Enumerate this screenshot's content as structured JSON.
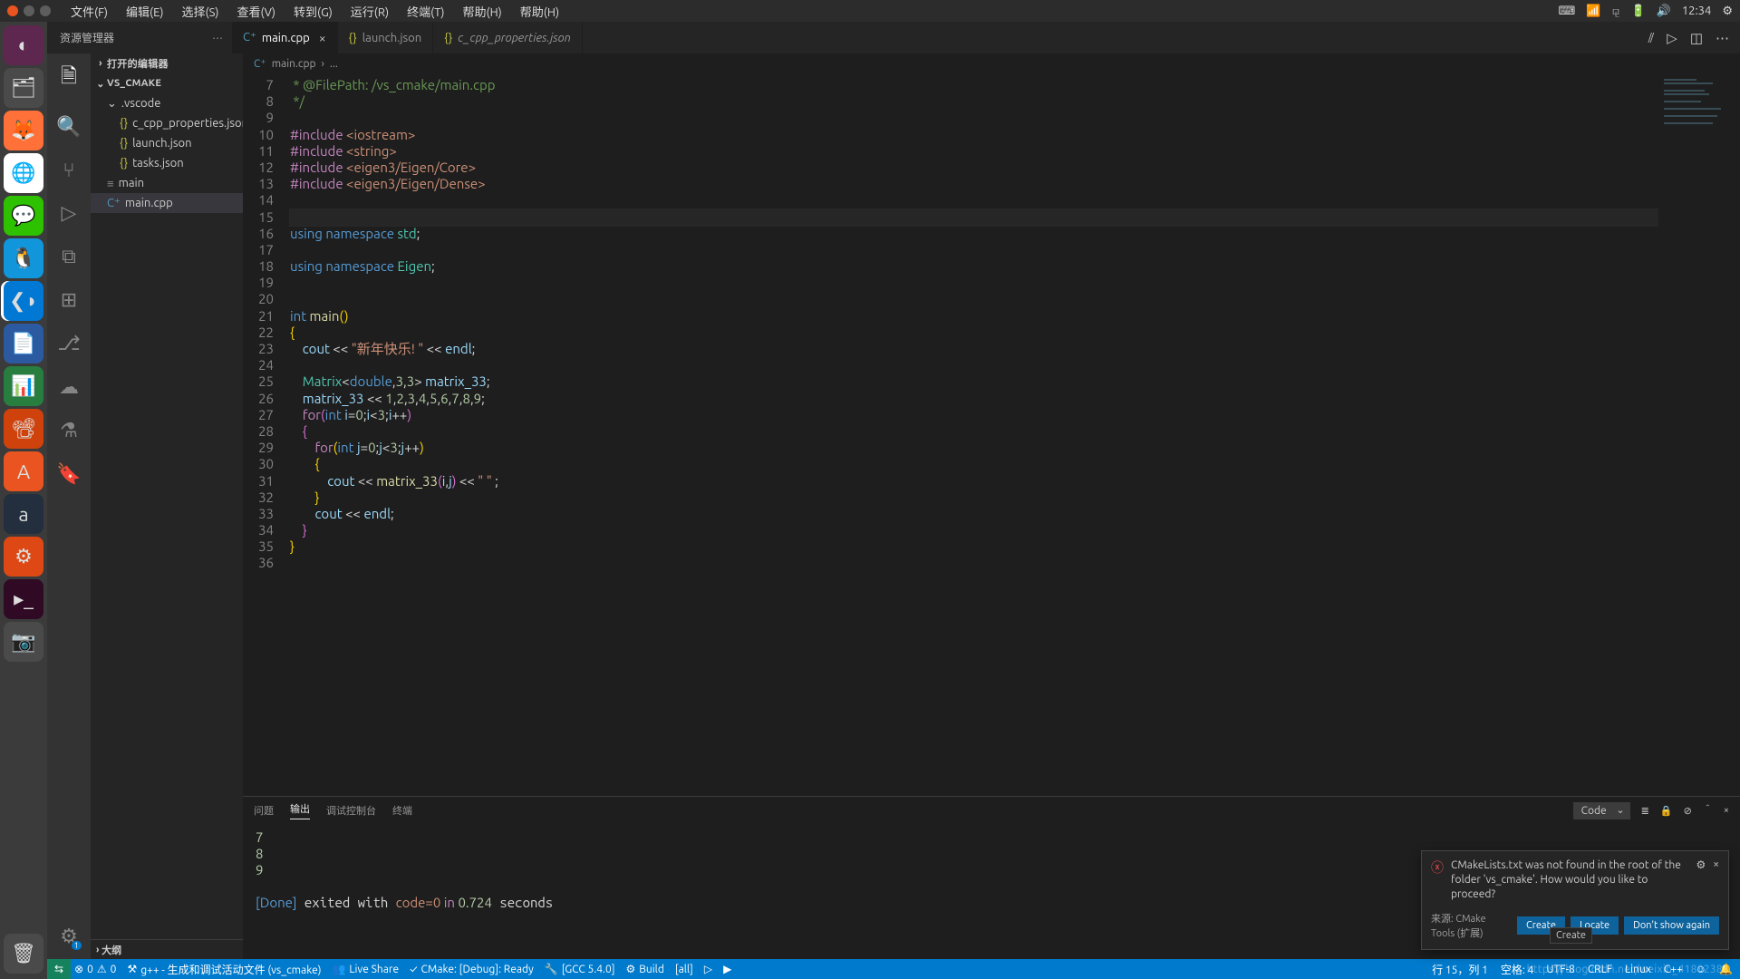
{
  "ubuntu": {
    "menus": [
      "文件(F)",
      "编辑(E)",
      "选择(S)",
      "查看(V)",
      "转到(G)",
      "运行(R)",
      "终端(T)",
      "帮助(H)",
      "帮助(H)"
    ],
    "time": "12:34"
  },
  "explorer": {
    "title": "资源管理器",
    "open_editors": "打开的编辑器",
    "workspace": "VS_CMAKE",
    "folder_vscode": ".vscode",
    "files": {
      "ccpp": "c_cpp_properties.json",
      "launch": "launch.json",
      "tasks": "tasks.json",
      "main_exe": "main",
      "main_cpp": "main.cpp"
    },
    "outline": "大纲"
  },
  "tabs": {
    "main": "main.cpp",
    "launch": "launch.json",
    "ccpp": "c_cpp_properties.json"
  },
  "breadcrumb": {
    "file": "main.cpp",
    "rest": "..."
  },
  "code_lines": [
    {
      "n": 7,
      "h": "<span class='c-cmt'> * @FilePath: /vs_cmake/main.cpp</span>"
    },
    {
      "n": 8,
      "h": "<span class='c-cmt'> */</span>"
    },
    {
      "n": 9,
      "h": ""
    },
    {
      "n": 10,
      "h": "<span class='c-kw'>#include</span> <span class='c-str'>&lt;iostream&gt;</span>"
    },
    {
      "n": 11,
      "h": "<span class='c-kw'>#include</span> <span class='c-str'>&lt;string&gt;</span>"
    },
    {
      "n": 12,
      "h": "<span class='c-kw'>#include</span> <span class='c-str'>&lt;eigen3/Eigen/Core&gt;</span>"
    },
    {
      "n": 13,
      "h": "<span class='c-kw'>#include</span> <span class='c-str'>&lt;eigen3/Eigen/Dense&gt;</span>"
    },
    {
      "n": 14,
      "h": ""
    },
    {
      "n": 15,
      "h": "",
      "curr": true
    },
    {
      "n": 16,
      "h": "<span class='c-kw2'>using</span> <span class='c-kw2'>namespace</span> <span class='c-ty'>std</span>;"
    },
    {
      "n": 17,
      "h": ""
    },
    {
      "n": 18,
      "h": "<span class='c-kw2'>using</span> <span class='c-kw2'>namespace</span> <span class='c-ty'>Eigen</span>;"
    },
    {
      "n": 19,
      "h": ""
    },
    {
      "n": 20,
      "h": ""
    },
    {
      "n": 21,
      "h": "<span class='c-kw2'>int</span> <span class='c-fn'>main</span><span class='c-br1'>()</span>"
    },
    {
      "n": 22,
      "h": "<span class='c-br1'>{</span>"
    },
    {
      "n": 23,
      "h": "    <span class='c-var'>cout</span> <span class='c-op'>&lt;&lt;</span> <span class='c-str'>\"新年快乐! \"</span> <span class='c-op'>&lt;&lt;</span> <span class='c-var'>endl</span>;"
    },
    {
      "n": 24,
      "h": ""
    },
    {
      "n": 25,
      "h": "    <span class='c-ty'>Matrix</span>&lt;<span class='c-kw2'>double</span>,<span class='c-nm'>3</span>,<span class='c-nm'>3</span>&gt; <span class='c-var'>matrix_33</span>;"
    },
    {
      "n": 26,
      "h": "    <span class='c-var'>matrix_33</span> <span class='c-op'>&lt;&lt;</span> <span class='c-nm'>1</span>,<span class='c-nm'>2</span>,<span class='c-nm'>3</span>,<span class='c-nm'>4</span>,<span class='c-nm'>5</span>,<span class='c-nm'>6</span>,<span class='c-nm'>7</span>,<span class='c-nm'>8</span>,<span class='c-nm'>9</span>;"
    },
    {
      "n": 27,
      "h": "    <span class='c-kw'>for</span><span class='c-br2'>(</span><span class='c-kw2'>int</span> <span class='c-var'>i</span>=<span class='c-nm'>0</span>;<span class='c-var'>i</span>&lt;<span class='c-nm'>3</span>;<span class='c-var'>i</span>++<span class='c-br2'>)</span>"
    },
    {
      "n": 28,
      "h": "    <span class='c-br2'>{</span>"
    },
    {
      "n": 29,
      "h": "        <span class='c-kw'>for</span><span class='c-br1'>(</span><span class='c-kw2'>int</span> <span class='c-var'>j</span>=<span class='c-nm'>0</span>;<span class='c-var'>j</span>&lt;<span class='c-nm'>3</span>;<span class='c-var'>j</span>++<span class='c-br1'>)</span>"
    },
    {
      "n": 30,
      "h": "        <span class='c-br1'>{</span>"
    },
    {
      "n": 31,
      "h": "            <span class='c-var'>cout</span> <span class='c-op'>&lt;&lt;</span> <span class='c-fn'>matrix_33</span><span class='c-br2'>(</span><span class='c-var'>i</span>,<span class='c-var'>j</span><span class='c-br2'>)</span> <span class='c-op'>&lt;&lt;</span> <span class='c-str'>\" \"</span> ;"
    },
    {
      "n": 32,
      "h": "        <span class='c-br1'>}</span>"
    },
    {
      "n": 33,
      "h": "        <span class='c-var'>cout</span> <span class='c-op'>&lt;&lt;</span> <span class='c-var'>endl</span>;"
    },
    {
      "n": 34,
      "h": "    <span class='c-br2'>}</span>"
    },
    {
      "n": 35,
      "h": "<span class='c-br1'>}</span>"
    },
    {
      "n": 36,
      "h": ""
    }
  ],
  "panel": {
    "tabs": {
      "problems": "问题",
      "output": "输出",
      "debug": "调试控制台",
      "terminal": "终端"
    },
    "selector": "Code",
    "out_nums": [
      "7",
      "8",
      "9"
    ],
    "done_line": {
      "done": "[Done]",
      "mid": " exited with ",
      "code": "code=0",
      "in": " in ",
      "time": "0.724",
      "suffix": " seconds"
    }
  },
  "status": {
    "errors": "0",
    "warnings": "0",
    "task": "g++ - 生成和调试活动文件 (vs_cmake)",
    "liveshare": "Live Share",
    "cmake": "CMake: [Debug]: Ready",
    "kit": "[GCC 5.4.0]",
    "build": "Build",
    "target": "[all]",
    "pos": "行 15，列 1",
    "spaces": "空格: 4",
    "enc": "UTF-8",
    "eol": "CRLF",
    "lang": "Linux",
    "bell": "C++"
  },
  "toast": {
    "msg": "CMakeLists.txt was not found in the root of the folder 'vs_cmake'. How would you like to proceed?",
    "src": "来源: CMake Tools (扩展)",
    "b1": "Create",
    "b2": "Locate",
    "b3": "Don't show again",
    "tip": "Create"
  },
  "watermark": "https://blog.csdn.net/weixin_41802388"
}
